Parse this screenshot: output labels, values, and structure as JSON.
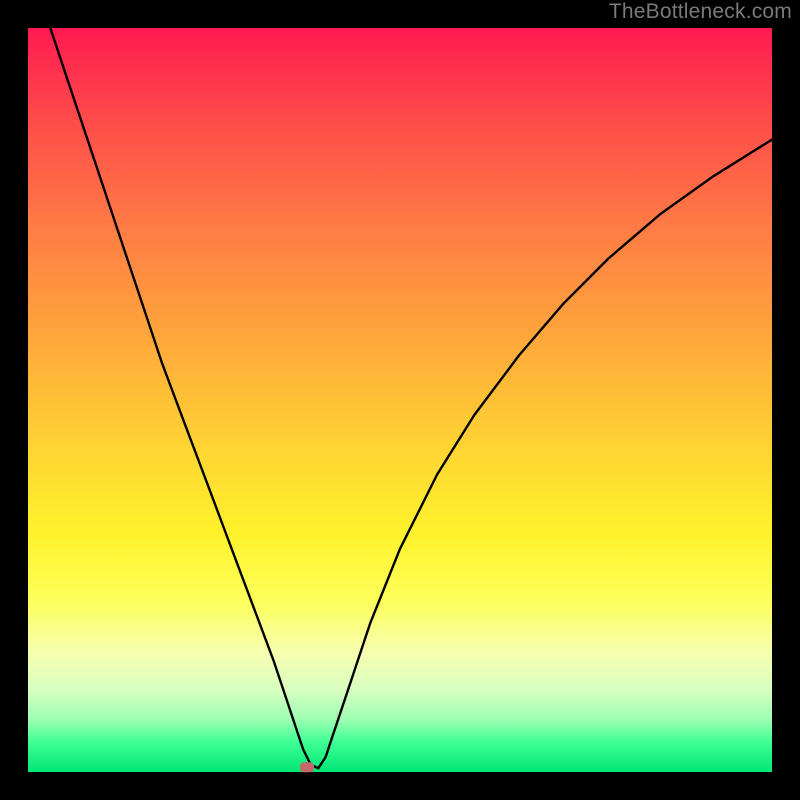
{
  "watermark": "TheBottleneck.com",
  "chart_data": {
    "type": "line",
    "title": "",
    "xlabel": "",
    "ylabel": "",
    "xlim": [
      0,
      100
    ],
    "ylim": [
      0,
      100
    ],
    "grid": false,
    "legend": false,
    "marker": {
      "x": 37.5,
      "y": 0.5
    },
    "series": [
      {
        "name": "bottleneck-curve",
        "x": [
          3,
          6,
          9,
          12,
          15,
          18,
          21,
          24,
          27,
          30,
          33,
          35,
          36,
          37,
          38,
          39,
          40,
          41,
          43,
          46,
          50,
          55,
          60,
          66,
          72,
          78,
          85,
          92,
          100
        ],
        "y": [
          100,
          91,
          82,
          73,
          64,
          55,
          47,
          39,
          31,
          23,
          15,
          9,
          6,
          3,
          1,
          0.5,
          2,
          5,
          11,
          20,
          30,
          40,
          48,
          56,
          63,
          69,
          75,
          80,
          85
        ]
      }
    ]
  }
}
